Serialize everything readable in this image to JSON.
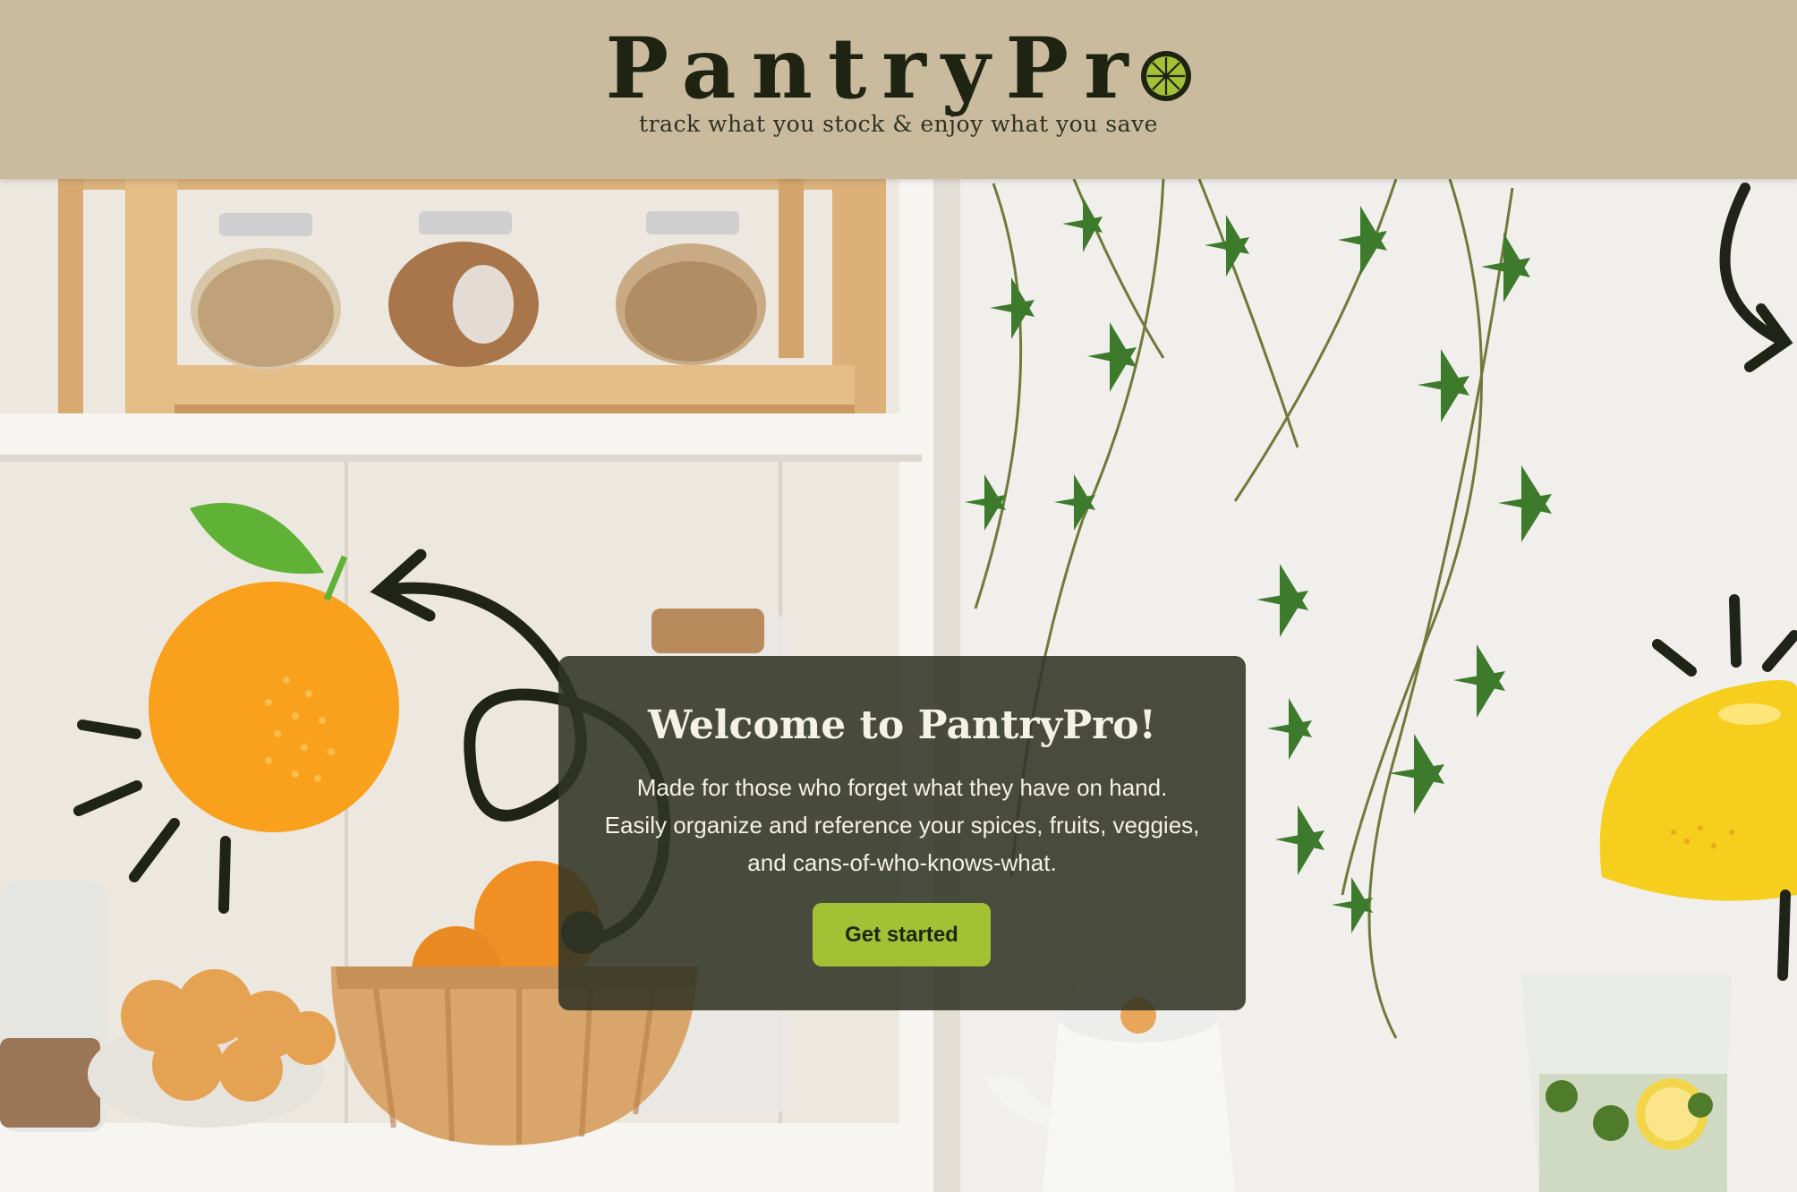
{
  "header": {
    "logo_text": "PantryPr",
    "tagline": "track what you stock & enjoy what you save"
  },
  "welcome": {
    "title": "Welcome to PantryPro!",
    "body": "Made for those who forget what they have on hand. Easily organize and reference your spices, fruits, veggies, and cans-of-who-knows-what.",
    "button_label": "Get started"
  },
  "colors": {
    "header_bg": "#cabb9f",
    "card_bg": "#313424",
    "accent_green": "#a4c035",
    "logo_text": "#1e2411"
  },
  "icons": {
    "logo_o": "lime-slice-icon",
    "illustrations": [
      "orange-illustration",
      "lemon-illustration",
      "arrow-doodle",
      "ivy-vines"
    ]
  }
}
